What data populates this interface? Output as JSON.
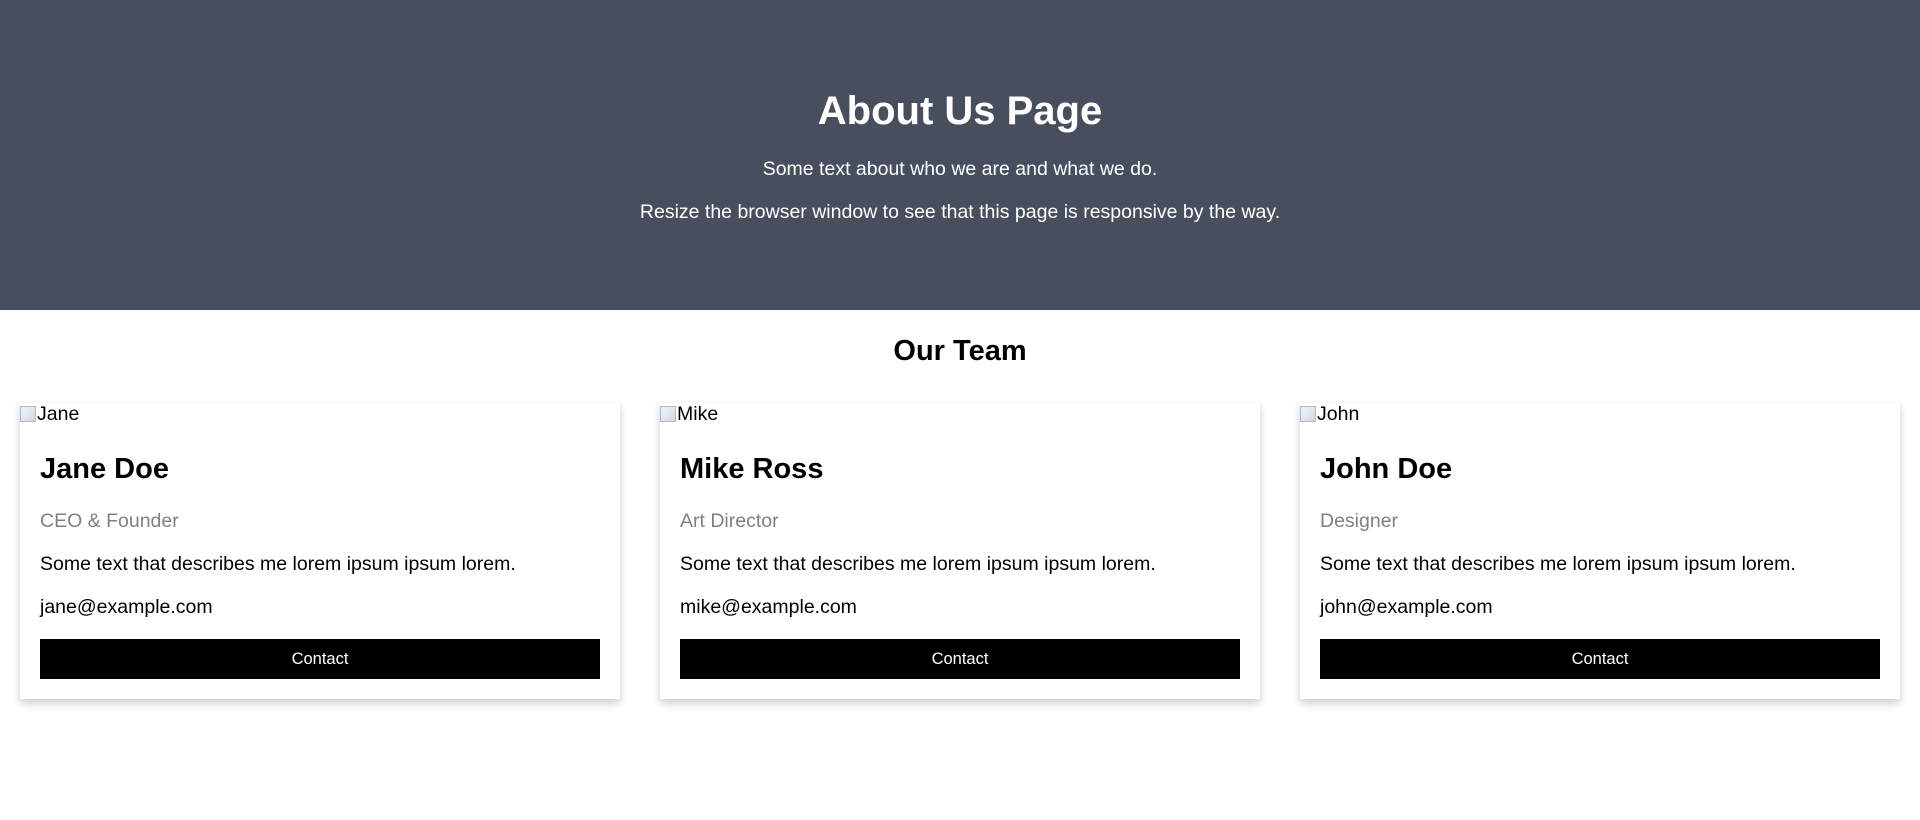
{
  "hero": {
    "title": "About Us Page",
    "line1": "Some text about who we are and what we do.",
    "line2": "Resize the browser window to see that this page is responsive by the way."
  },
  "team": {
    "heading": "Our Team",
    "members": [
      {
        "image_alt": "Jane",
        "name": "Jane Doe",
        "role": "CEO & Founder",
        "description": "Some text that describes me lorem ipsum ipsum lorem.",
        "email": "jane@example.com",
        "button_label": "Contact"
      },
      {
        "image_alt": "Mike",
        "name": "Mike Ross",
        "role": "Art Director",
        "description": "Some text that describes me lorem ipsum ipsum lorem.",
        "email": "mike@example.com",
        "button_label": "Contact"
      },
      {
        "image_alt": "John",
        "name": "John Doe",
        "role": "Designer",
        "description": "Some text that describes me lorem ipsum ipsum lorem.",
        "email": "john@example.com",
        "button_label": "Contact"
      }
    ]
  },
  "colors": {
    "hero_background": "#474e5d",
    "button_background": "#000000",
    "role_text": "#808080"
  }
}
